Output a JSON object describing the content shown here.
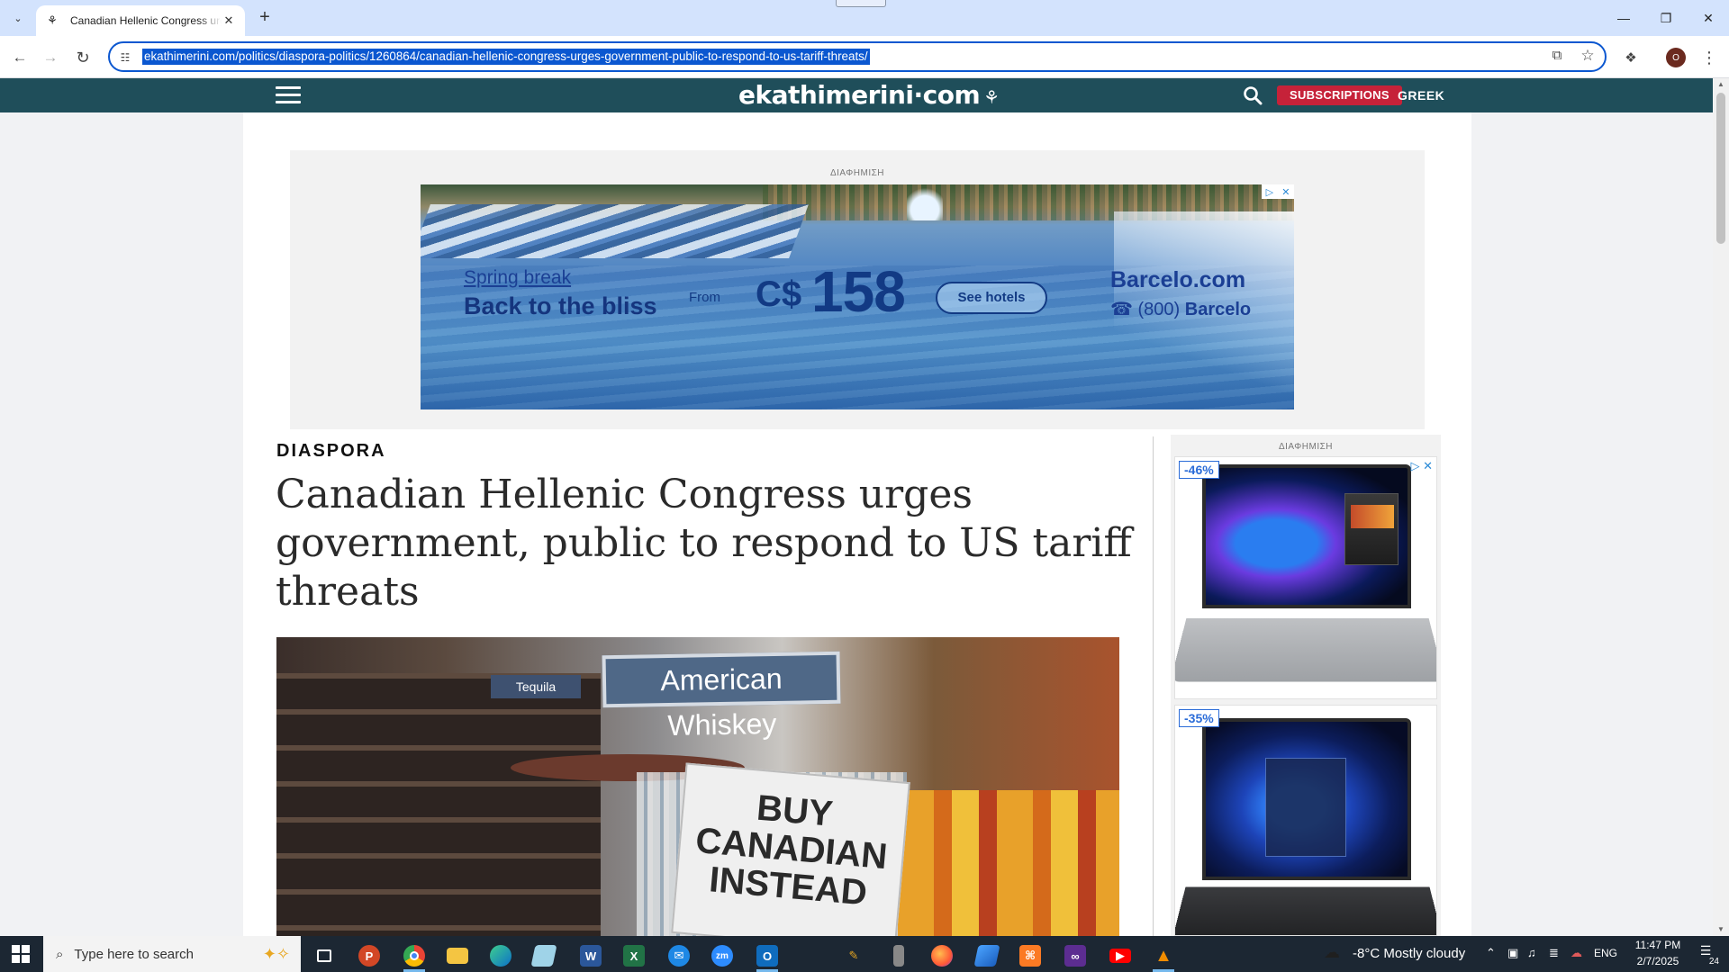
{
  "browser": {
    "tab_title": "Canadian Hellenic Congress urges government, public to respond to US tariff threats",
    "url": "ekathimerini.com/politics/diaspora-politics/1260864/canadian-hellenic-congress-urges-government-public-to-respond-to-us-tariff-threats/",
    "profile_initial": "O"
  },
  "site": {
    "logo": "ekathimerini·com",
    "subscriptions_label": "SUBSCRIPTIONS",
    "language_link": "GREEK",
    "ad_label": "ΔΙΑΦΗΜΙΣΗ"
  },
  "top_ad": {
    "tagline": "Spring break",
    "headline": "Back to the bliss",
    "from": "From",
    "currency": "C$",
    "price": "158",
    "cta": "See hotels",
    "brand": "Barcelo.com",
    "phone_prefix": "(800)",
    "phone_brand": "Barcelo"
  },
  "article": {
    "section": "DIASPORA",
    "headline": "Canadian Hellenic Congress urges government, public to respond to US tariff threats",
    "image_signs": {
      "main": "American Whiskey",
      "secondary": "Tequila",
      "buy_line1": "BUY",
      "buy_line2": "CANADIAN",
      "buy_line3": "INSTEAD"
    }
  },
  "right_ad": {
    "products": [
      {
        "discount": "-46%"
      },
      {
        "discount": "-35%"
      }
    ]
  },
  "taskbar": {
    "search_placeholder": "Type here to search",
    "weather": "-8°C  Mostly cloudy",
    "language": "ENG",
    "time": "11:47 PM",
    "date": "2/7/2025",
    "notification_count": "24"
  },
  "colors": {
    "header_bg": "#1f4e5a",
    "subscriptions_bg": "#c62239",
    "omnibox_focus": "#0b57d0"
  }
}
